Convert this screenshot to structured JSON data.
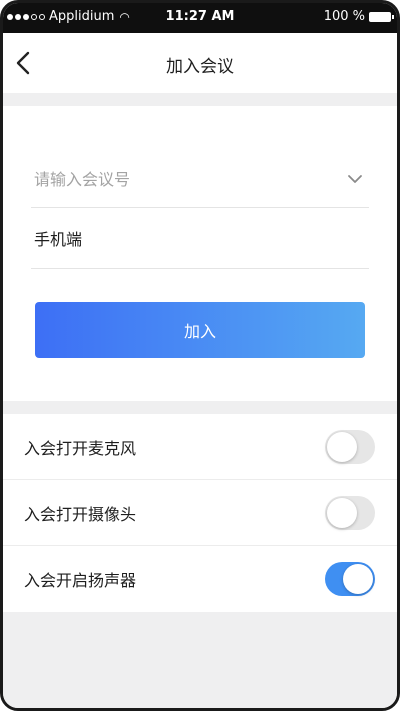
{
  "status_bar": {
    "carrier": "Applidium",
    "time": "11:27 AM",
    "battery": "100 %"
  },
  "nav": {
    "title": "加入会议",
    "back_icon": "chevron-left-icon"
  },
  "form": {
    "meeting_number": {
      "placeholder": "请输入会议号",
      "value": "",
      "dropdown_icon": "chevron-down-icon"
    },
    "display_name": {
      "value": "手机端"
    },
    "join_button": {
      "label": "加入",
      "gradient_start": "#3d6ff5",
      "gradient_end": "#56a9f2"
    }
  },
  "settings": [
    {
      "label": "入会打开麦克风",
      "enabled": false
    },
    {
      "label": "入会打开摄像头",
      "enabled": false
    },
    {
      "label": "入会开启扬声器",
      "enabled": true
    }
  ],
  "colors": {
    "toggle_on": "#3f8ff2",
    "toggle_off": "#e6e6e6",
    "page_background": "#efeff0"
  }
}
